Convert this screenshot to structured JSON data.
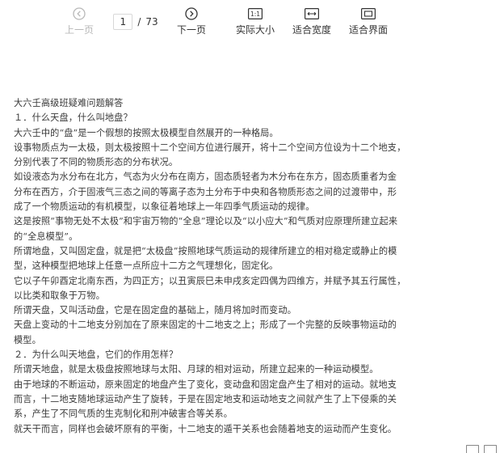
{
  "toolbar": {
    "prev_label": "上一页",
    "next_label": "下一页",
    "current_page": "1",
    "separator": "/",
    "total_pages": "73",
    "actual_size_label": "实际大小",
    "actual_size_icon_text": "1:1",
    "fit_width_label": "适合宽度",
    "fit_page_label": "适合界面"
  },
  "icons": {
    "prev": "circle-chevron-left-icon",
    "next": "circle-chevron-right-icon",
    "actual_size": "actual-size-icon",
    "fit_width": "fit-width-icon",
    "fit_page": "fit-page-icon"
  },
  "colors": {
    "toolbar_text": "#333333",
    "disabled_text": "#b8b8b8",
    "doc_text": "#3a3a3a"
  },
  "document": {
    "lines": [
      "大六壬高级班疑难问题解答",
      "１．什么天盘，什么叫地盘？",
      "大六壬中的“盘”是一个假想的按照太极模型自然展开的一种格局。",
      "设事物质点为一太极，则太极按照十二个空间方位进行展开，将十二个空间方位设为十二个地支，",
      "分别代表了不同的物质形态的分布状况。",
      "如设液态为水分布在北方，气态为火分布在南方，固态质轻者为木分布在东方，固态质重者为金",
      "分布在西方，介于固液气三态之间的等离子态为土分布于中央和各物质形态之间的过渡带中，形",
      "成了一个物质运动的有机模型，以象征着地球上一年四季气质运动的规律。",
      "这是按照“事物无处不太极”和宇宙万物的“全息”理论以及“以小应大”和气质对应原理所建立起来",
      "的“全息模型”。",
      "所谓地盘，又叫固定盘，就是把“太极盘”按照地球气质运动的规律所建立的相对稳定或静止的模",
      "型，这种模型把地球上任意一点所应十二方之气理想化，固定化。",
      "它以子午卯酉定北南东西，为四正方；以丑寅辰巳未申戌亥定四偶为四维方，并赋予其五行属性，",
      "以比类和取象于万物。",
      "所谓天盘，又叫活动盘，它是在固定盘的基础上，随月将加时而变动。",
      "天盘上变动的十二地支分别加在了原来固定的十二地支之上；形成了一个完整的反映事物运动的",
      "模型。",
      "２．为什么叫天地盘，它们的作用怎样？",
      "所谓天地盘，就是太极盘按照地球与太阳、月球的相对运动，所建立起来的一种运动模型。",
      "由于地球的不断运动，原来固定的地盘产生了变化，变动盘和固定盘产生了相对的运动。就地支",
      "而言，十二地支随地球运动产生了旋转，于是在固定地支和运动地支之间就产生了上下侵乘的关",
      "系，产生了不同气质的生克制化和刑冲破害合等关系。",
      "就天干而言，同样也会破坏原有的平衡，十二地支的遁干关系也会随着地支的运动而产生变化。"
    ]
  }
}
